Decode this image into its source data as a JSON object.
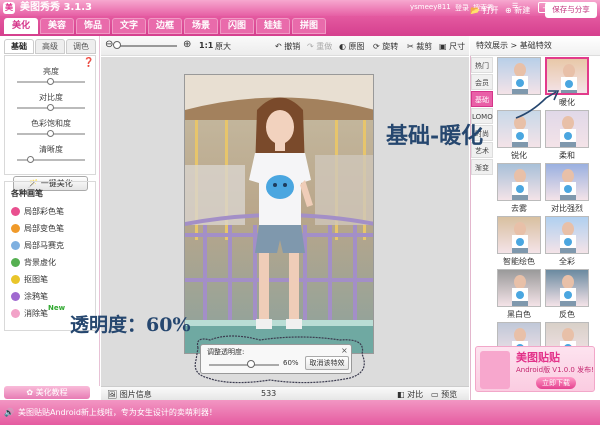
{
  "app": {
    "title": "美图秀秀 3.1.3",
    "logo": "美"
  },
  "titlebar": {
    "user": "ysmeey811",
    "login": "登录",
    "switch": "切换",
    "help": "帮助",
    "feedback": "搜索秀"
  },
  "nav": {
    "tabs": [
      "美化",
      "美容",
      "饰品",
      "文字",
      "边框",
      "场景",
      "闪图",
      "娃娃",
      "拼图"
    ],
    "open": "打开",
    "new": "新建",
    "save": "保存与分享"
  },
  "left": {
    "tabs": [
      "基础",
      "高级",
      "调色"
    ],
    "sliders": [
      {
        "label": "亮度",
        "value": 0.5
      },
      {
        "label": "对比度",
        "value": 0.5
      },
      {
        "label": "色彩饱和度",
        "value": 0.5
      },
      {
        "label": "清晰度",
        "value": 0.2
      }
    ],
    "oneclick": "一键美化",
    "brushes_title": "各种画笔",
    "brushes": [
      "局部彩色笔",
      "局部变色笔",
      "局部马赛克",
      "背景虚化",
      "抠图笔",
      "涂鸦笔",
      "消除笔"
    ],
    "new_badge": "New",
    "tutorial": "美化教程"
  },
  "toolbar": {
    "zoom_value": "1:1",
    "zoom_label": "原大",
    "undo": "撤销",
    "redo": "重做",
    "original": "原图",
    "rotate": "旋转",
    "crop": "裁剪",
    "size": "尺寸"
  },
  "popup": {
    "title": "调整透明度:",
    "value": "60%",
    "cancel": "取消该特效",
    "close": "×",
    "opacity": 0.6
  },
  "bottombar": {
    "info": "图片信息",
    "size": "533",
    "compare": "对比",
    "preview": "预览"
  },
  "right": {
    "header": "特效展示 > 基础特效",
    "tabs": [
      "热门",
      "会员",
      "基础",
      "LOMO",
      "时尚",
      "艺术",
      "渐变"
    ],
    "active_tab": 2,
    "effects": [
      "",
      "暖化",
      "锐化",
      "柔和",
      "去雾",
      "对比强烈",
      "智能绘色",
      "全彩",
      "黑白色",
      "反色",
      "",
      ""
    ]
  },
  "ad": {
    "title": "美图贴贴",
    "sub": "Android版 V1.0.0 发布!",
    "btn": "立即下载"
  },
  "status": {
    "text": "美图贴贴Android新上线啦，专为女生设计的卖萌利器！"
  },
  "annotations": {
    "effect": "基础-暖化",
    "opacity": "透明度：60%"
  }
}
